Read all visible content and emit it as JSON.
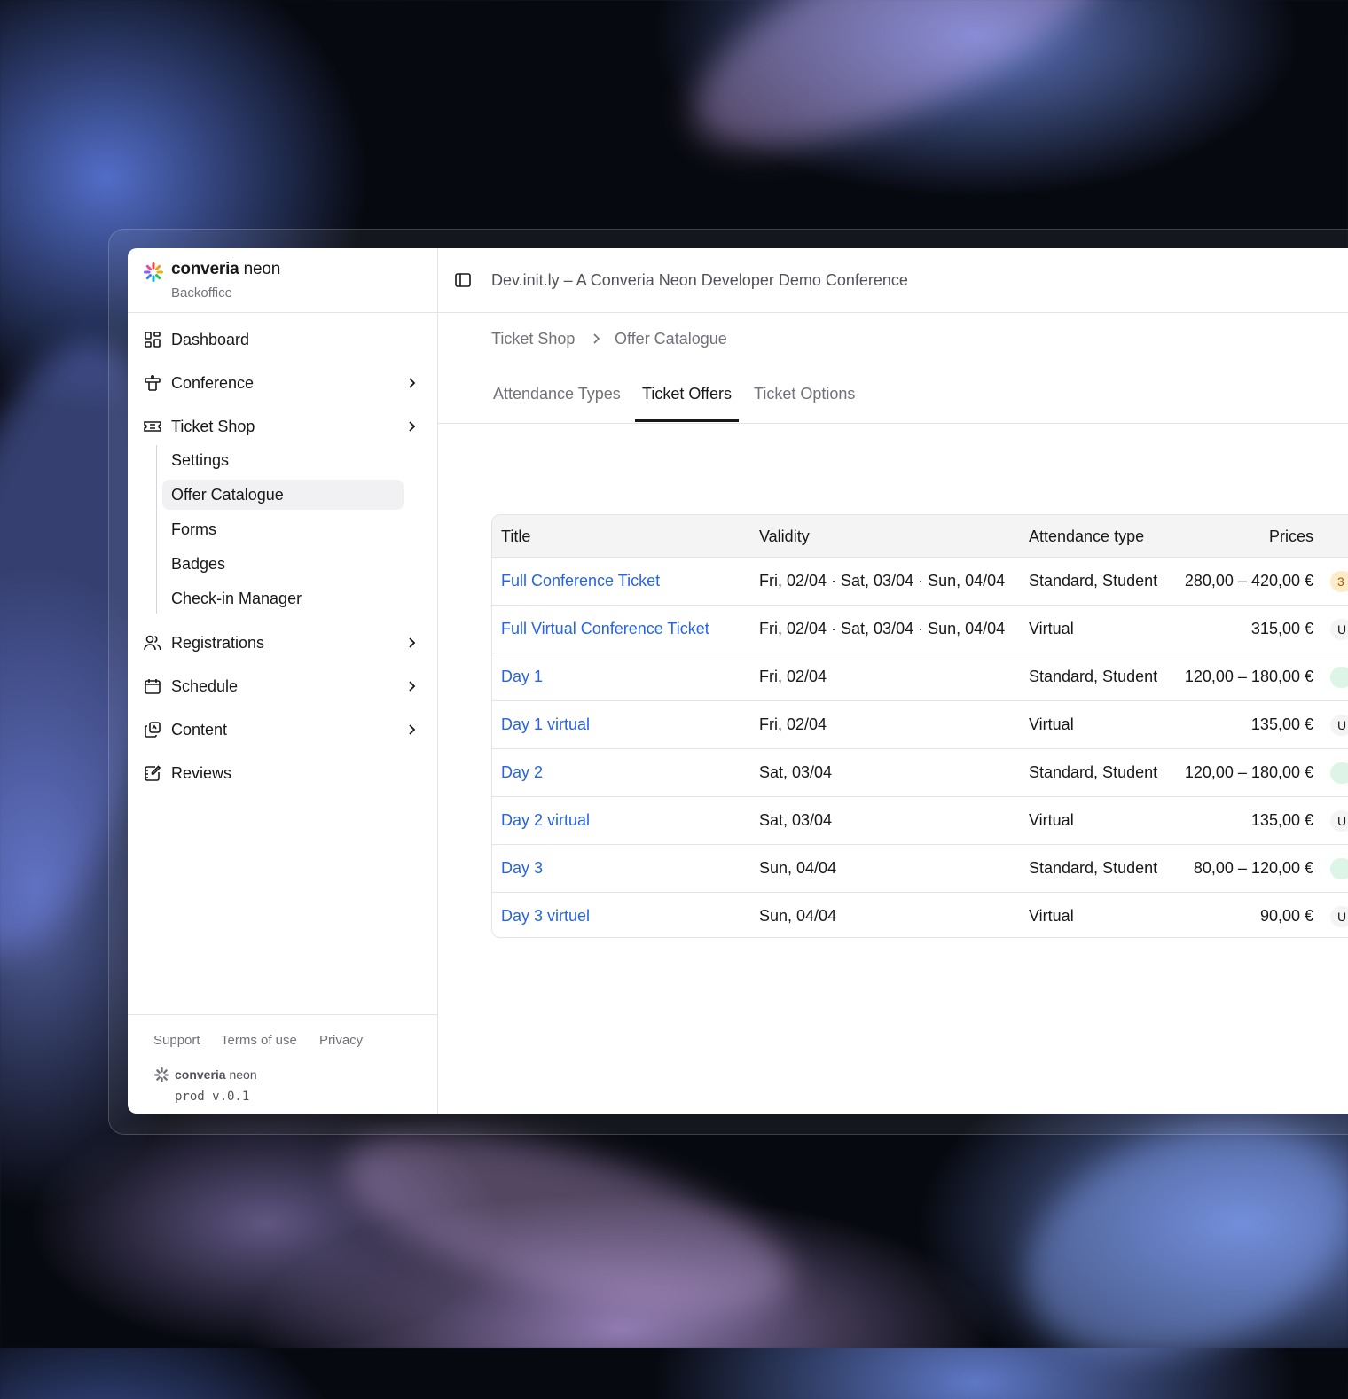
{
  "brand": {
    "name_bold": "converia",
    "name_light": "neon",
    "subtitle": "Backoffice"
  },
  "sidebar": {
    "items": [
      {
        "label": "Dashboard",
        "icon": "dashboard-icon",
        "has_children": false
      },
      {
        "label": "Conference",
        "icon": "podium-icon",
        "has_children": true
      },
      {
        "label": "Ticket Shop",
        "icon": "ticket-icon",
        "has_children": true
      },
      {
        "label": "Registrations",
        "icon": "users-icon",
        "has_children": true
      },
      {
        "label": "Schedule",
        "icon": "calendar-icon",
        "has_children": true
      },
      {
        "label": "Content",
        "icon": "copy-icon",
        "has_children": true
      },
      {
        "label": "Reviews",
        "icon": "review-icon",
        "has_children": false
      }
    ],
    "ticket_shop_children": [
      {
        "label": "Settings",
        "active": false
      },
      {
        "label": "Offer Catalogue",
        "active": true
      },
      {
        "label": "Forms",
        "active": false
      },
      {
        "label": "Badges",
        "active": false
      },
      {
        "label": "Check-in Manager",
        "active": false
      }
    ]
  },
  "footer": {
    "links": [
      "Support",
      "Terms of use",
      "Privacy"
    ],
    "brand_bold": "converia",
    "brand_light": "neon",
    "version": "prod v.0.1"
  },
  "header": {
    "conference_title": "Dev.init.ly – A Converia Neon Developer Demo Conference"
  },
  "breadcrumb": [
    "Ticket Shop",
    "Offer Catalogue"
  ],
  "tabs": [
    {
      "label": "Attendance Types",
      "active": false
    },
    {
      "label": "Ticket Offers",
      "active": true
    },
    {
      "label": "Ticket Options",
      "active": false
    }
  ],
  "table": {
    "columns": [
      "Title",
      "Validity",
      "Attendance type",
      "Prices"
    ],
    "rows": [
      {
        "title": "Full Conference Ticket",
        "validity": "Fri, 02/04 · Sat, 03/04 · Sun, 04/04",
        "attendance": "Standard, Student",
        "prices": "280,00 – 420,00  €",
        "badge": "3",
        "badge_color": "#fdecc8"
      },
      {
        "title": "Full Virtual Conference Ticket",
        "validity": "Fri, 02/04 · Sat, 03/04 · Sun, 04/04",
        "attendance": "Virtual",
        "prices": "315,00  €",
        "badge": "U",
        "badge_color": "#f4f4f5"
      },
      {
        "title": "Day 1",
        "validity": "Fri, 02/04",
        "attendance": "Standard, Student",
        "prices": "120,00 – 180,00  €",
        "badge": "",
        "badge_color": "#dcf5e7"
      },
      {
        "title": "Day 1 virtual",
        "validity": "Fri, 02/04",
        "attendance": "Virtual",
        "prices": "135,00  €",
        "badge": "U",
        "badge_color": "#f4f4f5"
      },
      {
        "title": "Day 2",
        "validity": "Sat, 03/04",
        "attendance": "Standard, Student",
        "prices": "120,00 – 180,00 €",
        "badge": "",
        "badge_color": "#dcf5e7"
      },
      {
        "title": "Day 2 virtual",
        "validity": "Sat, 03/04",
        "attendance": "Virtual",
        "prices": "135,00  €",
        "badge": "U",
        "badge_color": "#f4f4f5"
      },
      {
        "title": "Day 3",
        "validity": "Sun, 04/04",
        "attendance": "Standard, Student",
        "prices": "80,00 – 120,00  €",
        "badge": "",
        "badge_color": "#dcf5e7"
      },
      {
        "title": "Day 3 virtuel",
        "validity": "Sun, 04/04",
        "attendance": "Virtual",
        "prices": "90,00  €",
        "badge": "U",
        "badge_color": "#f4f4f5"
      }
    ]
  },
  "colors": {
    "link": "#2563eb",
    "text": "#18181b",
    "muted": "#71717a",
    "active_bg": "#f1f1f3"
  }
}
